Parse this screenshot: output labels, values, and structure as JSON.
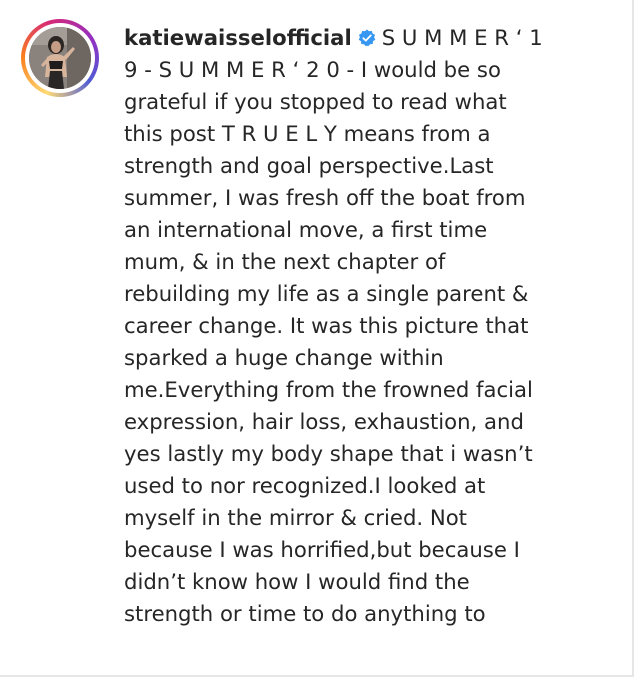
{
  "post": {
    "username": "katiewaisselofficial",
    "verified": true,
    "verified_icon": "verified-badge-icon",
    "accent_color": "#3897f0",
    "first_line_text": "S U M M E R ‘ 1",
    "caption_lines": [
      "9 - S U M M E R ‘ 2 0 - I would be so",
      "grateful if you stopped to read what",
      "this post T R U E L Y means from a",
      "strength and goal perspective.Last",
      "summer, I was fresh off the boat from",
      "an international move, a first time",
      "mum, & in the next chapter of",
      "rebuilding my life as a single parent &",
      "career change. It was this picture that",
      "sparked a huge change within",
      "me.Everything from the frowned facial",
      "expression, hair loss, exhaustion, and",
      "yes lastly my body shape that i wasn’t",
      "used to nor recognized.I looked at",
      "myself in the mirror & cried. Not",
      "because I was horrified,but because I",
      "didn’t know how I would find the",
      "strength or time to do anything to"
    ]
  }
}
